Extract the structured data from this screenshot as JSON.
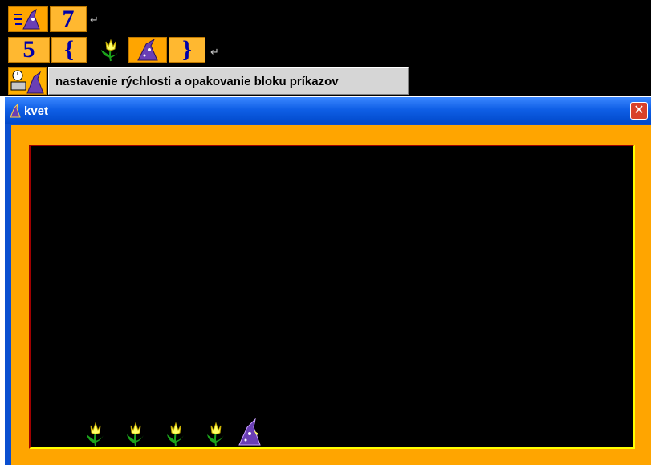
{
  "code_lines": [
    {
      "tokens": [
        {
          "type": "icon",
          "icon": "wizard-speed-icon"
        },
        {
          "type": "text",
          "text": "7"
        }
      ]
    },
    {
      "tokens": [
        {
          "type": "text",
          "text": "5"
        },
        {
          "type": "text",
          "text": "{"
        },
        {
          "type": "icon",
          "icon": "flower-icon"
        },
        {
          "type": "icon",
          "icon": "wizard-icon"
        },
        {
          "type": "text",
          "text": "}"
        }
      ]
    }
  ],
  "line1": {
    "speed_value": "7"
  },
  "line2": {
    "repeat_count": "5",
    "block_open": "{",
    "block_close": "}"
  },
  "return_symbol": "↵",
  "status": {
    "label": "nastavenie rýchlosti a opakovanie bloku príkazov"
  },
  "window": {
    "title": "kvet",
    "close_symbol": "✕"
  },
  "canvas": {
    "flowers": 4,
    "sprite": "wizard-icon"
  },
  "colors": {
    "tile": "#ffa500",
    "text_blue": "#0000a8",
    "titlebar": "#0f5fe6",
    "canvas_bg": "#000000"
  }
}
